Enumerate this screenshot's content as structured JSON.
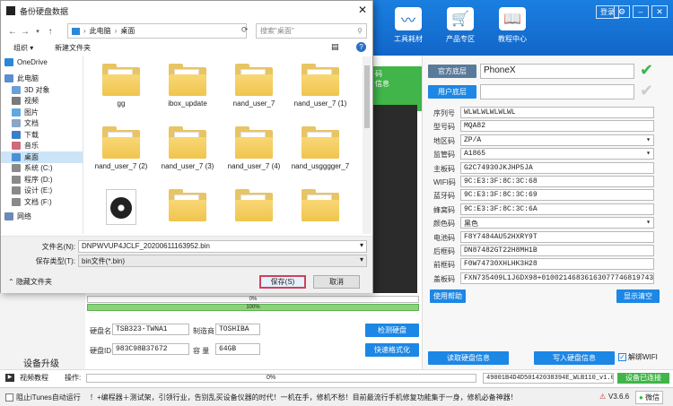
{
  "app": {
    "header": {
      "buttons": [
        {
          "label": "工具耗材"
        },
        {
          "label": "产品专区"
        },
        {
          "label": "教程中心"
        }
      ],
      "login_label": "登录"
    },
    "left": {
      "device_upgrade": "设备升级",
      "tile_text": "码\n信息"
    },
    "progress1": "0%",
    "progress2": "100%",
    "disk": {
      "name_label": "硬盘名",
      "name_value": "TSB323-TWNA1",
      "maker_label": "制造商",
      "maker_value": "TOSHIBA",
      "id_label": "硬盘ID",
      "id_value": "983C98B37672",
      "cap_label": "容 量",
      "cap_value": "64GB",
      "detect_btn": "检测硬盘",
      "format_btn": "快速格式化"
    },
    "right": {
      "official_btn": "官方底层",
      "official_value": "PhoneX",
      "user_btn": "用户底层",
      "user_value": "",
      "fields": [
        {
          "label": "序列号",
          "value": "WLWLWLWLWLWL",
          "dd": false
        },
        {
          "label": "型号码",
          "value": "MQA82",
          "dd": false
        },
        {
          "label": "地区码",
          "value": "ZP/A",
          "dd": true
        },
        {
          "label": "监管码",
          "value": "A1865",
          "dd": true
        },
        {
          "label": "主板码",
          "value": "G2C74930JKJHP5JA",
          "dd": false
        },
        {
          "label": "WIFI码",
          "value": "9C:E3:3F:8C:3C:68",
          "dd": false
        },
        {
          "label": "蓝牙码",
          "value": "9C:E3:3F:8C:3C:69",
          "dd": false
        },
        {
          "label": "蜂窝码",
          "value": "9C:E3:3F:8C:3C:6A",
          "dd": false
        },
        {
          "label": "颜色码",
          "value": "黑色",
          "dd": true
        },
        {
          "label": "电池码",
          "value": "F8Y7484AU52HXRY9T",
          "dd": false
        },
        {
          "label": "后框码",
          "value": "DN87482GT22H8MH1B",
          "dd": false
        },
        {
          "label": "前框码",
          "value": "F0W74730XHLHK3H28",
          "dd": false
        },
        {
          "label": "盖板码",
          "value": "FXN735409L1J6DX98+01002146836163077746819743",
          "dd": false
        }
      ],
      "use_help": "使用帮助",
      "show_clear": "显示清空",
      "read_disk": "读取硬盘信息",
      "write_disk": "写入硬盘信息",
      "unbind_wifi": "解绑WIFI"
    },
    "status": {
      "video_label": "视频教程",
      "op_label": "操作:",
      "progress": "0%",
      "file_select": "49001B4D4D50142038394E_WLB110_v1.0.",
      "connected": "设备已连接"
    },
    "bottom": {
      "block_itunes": "阻止iTunes自动运行",
      "marquee": "！+编程器＋测试架，引领行业，告别乱买设备仪器的时代！一机在手，修机不愁！目前最流行手机修复功能集于一身，修机必备神器！",
      "version": "V3.6.6",
      "wechat": "微信"
    }
  },
  "dialog": {
    "title": "备份硬盘数据",
    "path": [
      "此电脑",
      "桌面"
    ],
    "search_placeholder": "搜索\"桌面\"",
    "organize": "组织 ▾",
    "new_folder": "新建文件夹",
    "nav": [
      {
        "label": "OneDrive",
        "color": "#2b88d8"
      },
      {
        "label": "此电脑",
        "color": "#5a8fd0"
      },
      {
        "label": "3D 对象",
        "color": "#6aa0d8"
      },
      {
        "label": "视频",
        "color": "#7a7a7a"
      },
      {
        "label": "图片",
        "color": "#5fa8e0"
      },
      {
        "label": "文档",
        "color": "#8aa6c8"
      },
      {
        "label": "下载",
        "color": "#3a80c8"
      },
      {
        "label": "音乐",
        "color": "#d06a7a"
      },
      {
        "label": "桌面",
        "color": "#4a90d8"
      },
      {
        "label": "系统 (C:)",
        "color": "#8a8a8a"
      },
      {
        "label": "程序 (D:)",
        "color": "#8a8a8a"
      },
      {
        "label": "设计 (E:)",
        "color": "#8a8a8a"
      },
      {
        "label": "文档 (F:)",
        "color": "#8a8a8a"
      },
      {
        "label": "网络",
        "color": "#6a8ab8"
      }
    ],
    "files": [
      {
        "name": "gg",
        "kind": "folder"
      },
      {
        "name": "ibox_update",
        "kind": "folder-red"
      },
      {
        "name": "nand_user_7",
        "kind": "folder"
      },
      {
        "name": "nand_user_7 (1)",
        "kind": "folder"
      },
      {
        "name": "nand_user_7 (2)",
        "kind": "folder"
      },
      {
        "name": "nand_user_7 (3)",
        "kind": "folder"
      },
      {
        "name": "nand_user_7 (4)",
        "kind": "folder"
      },
      {
        "name": "nand_usgggger_7",
        "kind": "folder"
      },
      {
        "name": "",
        "kind": "disc"
      },
      {
        "name": "",
        "kind": "folder"
      },
      {
        "name": "",
        "kind": "folder"
      },
      {
        "name": "",
        "kind": "folder"
      }
    ],
    "filename_label": "文件名(N):",
    "filename_value": "DNPWVUP4JCLF_20200611163952.bin",
    "filetype_label": "保存类型(T):",
    "filetype_value": "bin文件(*.bin)",
    "hide_folders": "隐藏文件夹",
    "save_btn": "保存(S)",
    "cancel_btn": "取消"
  }
}
